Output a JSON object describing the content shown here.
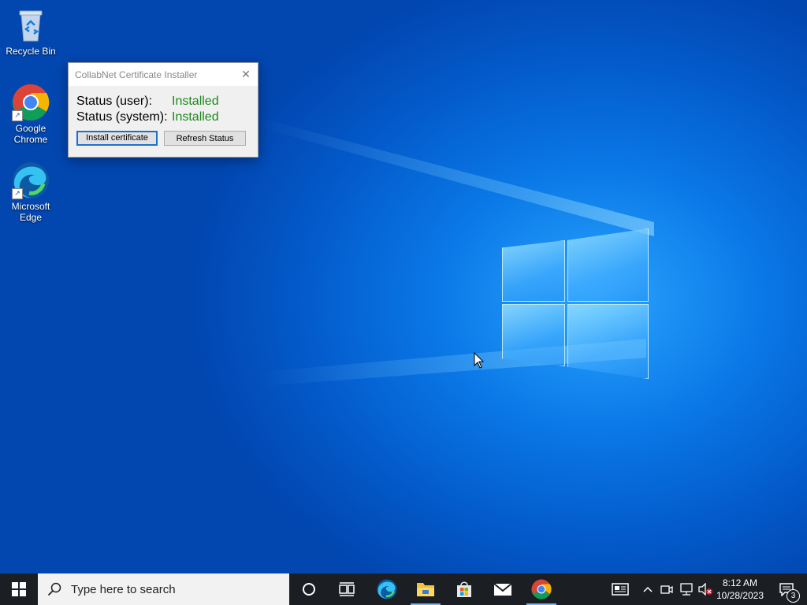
{
  "desktop": {
    "icons": [
      {
        "label": "Recycle Bin"
      },
      {
        "label": "Google Chrome"
      },
      {
        "label": "Microsoft Edge"
      }
    ]
  },
  "dialog": {
    "title": "CollabNet Certificate Installer",
    "rows": [
      {
        "label": "Status (user):",
        "value": "Installed"
      },
      {
        "label": "Status (system):",
        "value": "Installed"
      }
    ],
    "install_button": "Install certificate",
    "refresh_button": "Refresh Status",
    "status_color": "#1a8a1a"
  },
  "taskbar": {
    "search_placeholder": "Type here to search",
    "apps": [
      "edge-icon",
      "file-explorer-icon",
      "store-icon",
      "mail-icon",
      "chrome-icon"
    ],
    "clock_time": "8:12 AM",
    "clock_date": "10/28/2023",
    "notification_count": "3"
  }
}
